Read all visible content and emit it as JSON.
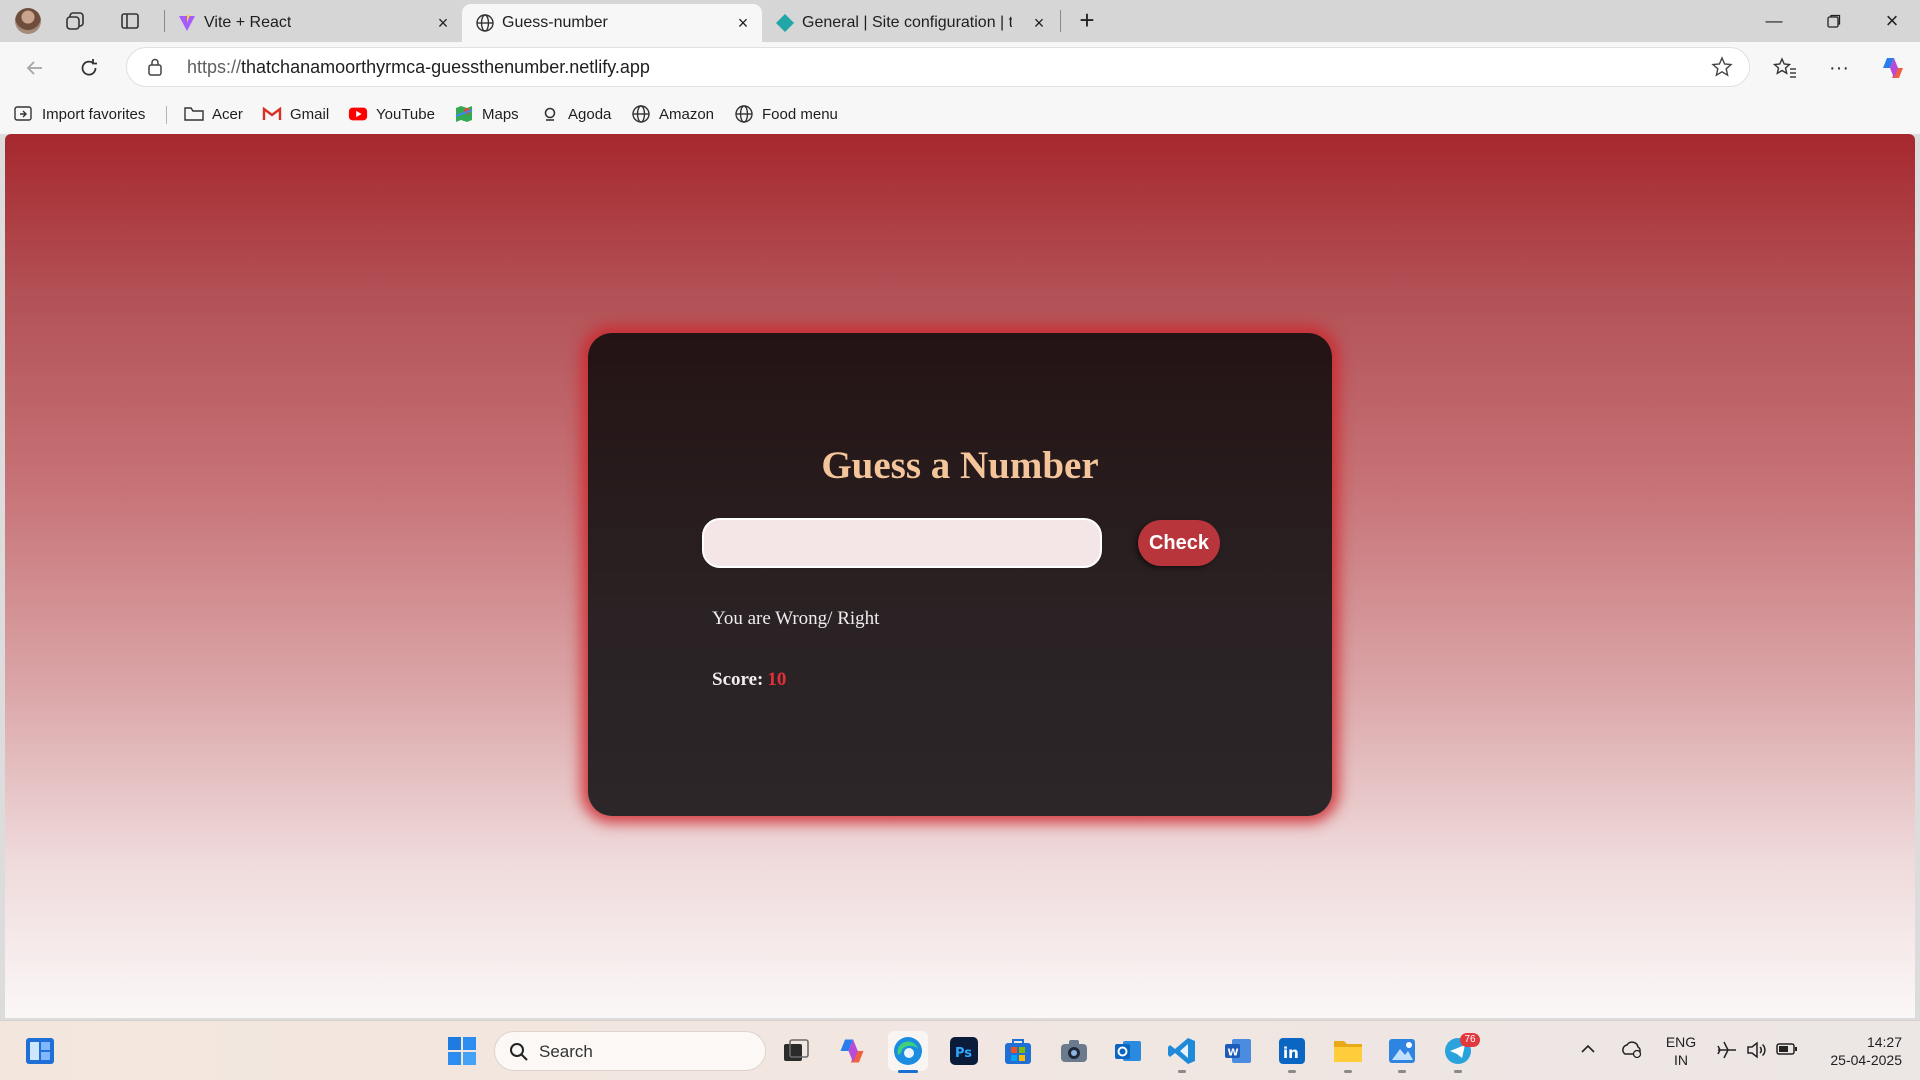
{
  "browser": {
    "tabs": [
      {
        "title": "Vite + React",
        "favicon": "vite-icon"
      },
      {
        "title": "Guess-number",
        "favicon": "globe-icon",
        "active": true
      },
      {
        "title": "General | Site configuration | thatc",
        "favicon": "netlify-icon"
      }
    ],
    "address": {
      "protocol": "https://",
      "host": "thatchanamoorthyrmca-guessthenumber.netlify.app"
    },
    "bookmarks": [
      {
        "label": "Import favorites",
        "icon": "import-icon"
      },
      {
        "label": "Acer",
        "icon": "folder-icon"
      },
      {
        "label": "Gmail",
        "icon": "gmail-icon"
      },
      {
        "label": "YouTube",
        "icon": "youtube-icon"
      },
      {
        "label": "Maps",
        "icon": "maps-icon"
      },
      {
        "label": "Agoda",
        "icon": "agoda-icon"
      },
      {
        "label": "Amazon",
        "icon": "globe-icon"
      },
      {
        "label": "Food menu",
        "icon": "globe-icon"
      }
    ]
  },
  "page": {
    "title": "Guess a Number",
    "input_value": "",
    "check_label": "Check",
    "result_message": "You are Wrong/ Right",
    "score_label": "Score:",
    "score_value": "10"
  },
  "taskbar": {
    "search_placeholder": "Search",
    "language": {
      "line1": "ENG",
      "line2": "IN"
    },
    "time": "14:27",
    "date": "25-04-2025",
    "telegram_badge": "76"
  },
  "colors": {
    "accent_red": "#b8353c",
    "title_gold": "#f4c59a",
    "score_red": "#e2303b",
    "card_bg": "#2a2224"
  }
}
